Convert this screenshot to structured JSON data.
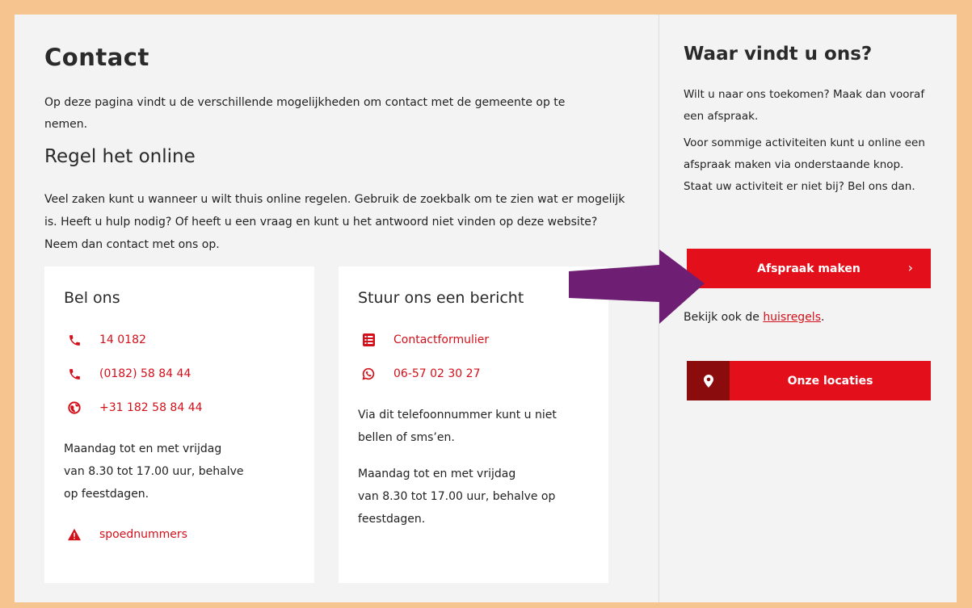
{
  "main": {
    "title": "Contact",
    "intro": "Op deze pagina vindt u de verschillende mogelijkheden om contact met de gemeente op te nemen.",
    "section_title": "Regel het online",
    "section_text": "Veel zaken kunt u wanneer u wilt thuis online regelen. Gebruik de zoekbalk om te zien wat er mogelijk is. Heeft u hulp nodig? Of heeft u een vraag en kunt u het antwoord niet vinden op deze website? Neem dan contact met ons op."
  },
  "card_call": {
    "title": "Bel ons",
    "links": [
      {
        "label": "14 0182",
        "icon": "phone-icon"
      },
      {
        "label": "(0182) 58 84 44",
        "icon": "phone-icon"
      },
      {
        "label": "+31 182 58 84 44",
        "icon": "globe-icon"
      }
    ],
    "hours_line1": "Maandag tot en met vrijdag",
    "hours_line2": "van 8.30 tot 17.00 uur, behalve op feestdagen.",
    "emergency_label": "spoednummers",
    "emergency_icon": "warning-icon"
  },
  "card_message": {
    "title": "Stuur ons een bericht",
    "links": [
      {
        "label": "Contactformulier",
        "icon": "form-icon"
      },
      {
        "label": "06-57 02 30 27",
        "icon": "whatsapp-icon"
      }
    ],
    "note": "Via dit telefoonnummer kunt u niet bellen of sms’en.",
    "hours_line1": "Maandag tot en met vrijdag",
    "hours_line2": "van 8.30 tot 17.00 uur, behalve op feestdagen."
  },
  "aside": {
    "title": "Waar vindt u ons?",
    "text1": "Wilt u naar ons toekomen? Maak dan vooraf een afspraak.",
    "text2": "Voor sommige activiteiten kunt u online een afspraak maken via onderstaande knop. Staat uw activiteit er niet bij? Bel ons dan.",
    "appointment_button": "Afspraak maken",
    "appointment_chevron": "›",
    "see_also_prefix": "Bekijk ook de ",
    "see_also_link": "huisregels",
    "see_also_suffix": ".",
    "locations_button": "Onze locaties"
  },
  "colors": {
    "accent": "#e3101c",
    "link": "#d3101a",
    "pin_bg": "#8a0c0c",
    "arrow": "#6e1f73",
    "frame_border": "#f6c58f",
    "background": "#f3f3f3"
  }
}
